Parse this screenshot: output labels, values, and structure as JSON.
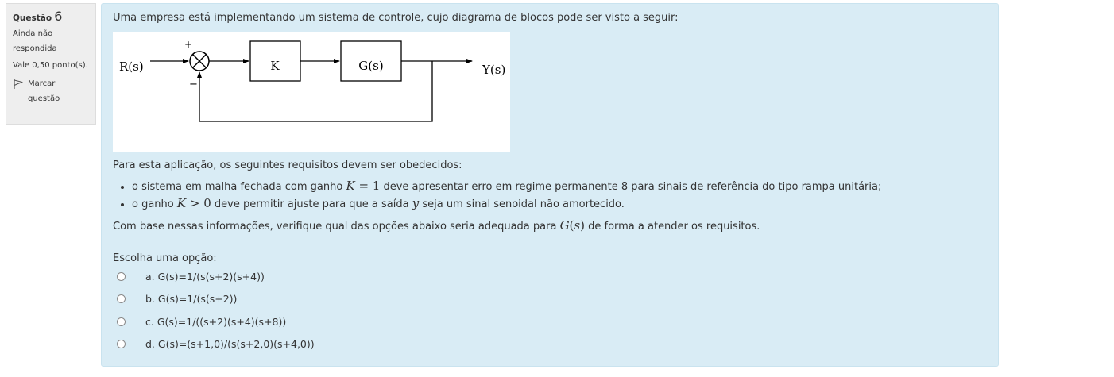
{
  "info": {
    "question_label": "Questão",
    "question_number": "6",
    "state": "Ainda não respondida",
    "grade": "Vale 0,50 ponto(s).",
    "flag_label": "Marcar questão"
  },
  "question": {
    "intro": "Uma empresa está implementando um sistema de controle, cujo diagrama de blocos pode ser visto a seguir:",
    "diagram": {
      "input": "R(s)",
      "output": "Y(s)",
      "gain_block": "K",
      "plant_block": "G(s)",
      "plus_sign": "+",
      "minus_sign": "−"
    },
    "requirements_intro": "Para esta aplicação, os seguintes requisitos devem ser obedecidos:",
    "req1": {
      "before": "o sistema em malha fechada com ganho",
      "math_var": "K",
      "math_rest": " = 1",
      "after": "deve apresentar erro em regime permanente 8 para sinais de referência do tipo rampa unitária;"
    },
    "req2": {
      "before": "o ganho",
      "math_var": "K",
      "math_rest": " > 0",
      "middle": "deve permitir ajuste para que a saída",
      "math_y": "y",
      "after": "seja um sinal senoidal não amortecido."
    },
    "based": {
      "before": "Com base nessas informações, verifique qual das opções abaixo seria adequada para",
      "math_g": "G",
      "math_open": "(",
      "math_s": "s",
      "math_close": ")",
      "after": "de forma a atender os requisitos."
    },
    "prompt": "Escolha uma opção:",
    "options": [
      "a. G(s)=1/(s(s+2)(s+4))",
      "b. G(s)=1/(s(s+2))",
      "c. G(s)=1/((s+2)(s+4)(s+8))",
      "d. G(s)=(s+1,0)/(s(s+2,0)(s+4,0))"
    ]
  }
}
